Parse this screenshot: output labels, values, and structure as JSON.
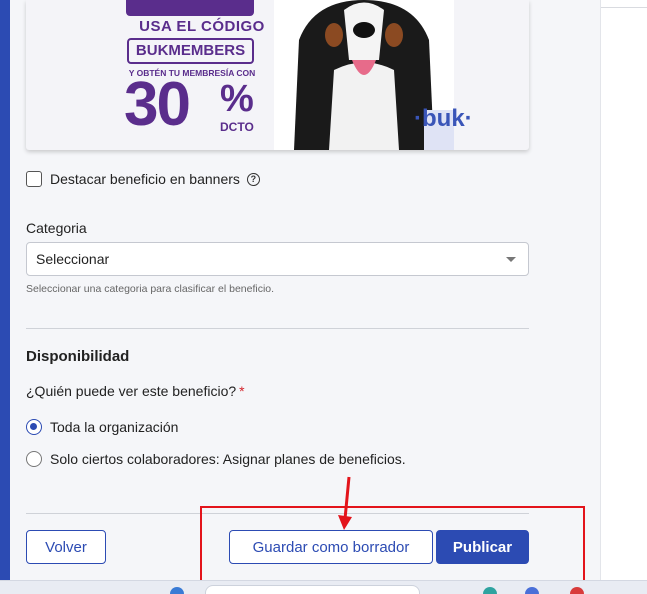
{
  "banner": {
    "line1": "USA EL CÓDIGO",
    "code": "BUKMEMBERS",
    "line3": "Y OBTÉN TU MEMBRESÍA CON",
    "discount_number": "30",
    "discount_symbol": "%",
    "discount_suffix": "DCTO",
    "brand": "·buk·"
  },
  "highlight": {
    "label": "Destacar beneficio en banners",
    "checked": false,
    "help_icon": "question-circle-icon"
  },
  "category": {
    "label": "Categoria",
    "selected": "Seleccionar",
    "hint": "Seleccionar una categoria para clasificar el beneficio."
  },
  "availability": {
    "title": "Disponibilidad",
    "question": "¿Quién puede ver este beneficio?",
    "required_mark": "*",
    "options": [
      {
        "label": "Toda la organización",
        "selected": true
      },
      {
        "label": "Solo ciertos colaboradores: Asignar planes de beneficios.",
        "selected": false
      }
    ]
  },
  "actions": {
    "back": "Volver",
    "save_draft": "Guardar como borrador",
    "publish": "Publicar"
  },
  "colors": {
    "accent": "#2c4bb3",
    "banner_purple": "#5a2d8c",
    "annotation_red": "#e3141b"
  }
}
